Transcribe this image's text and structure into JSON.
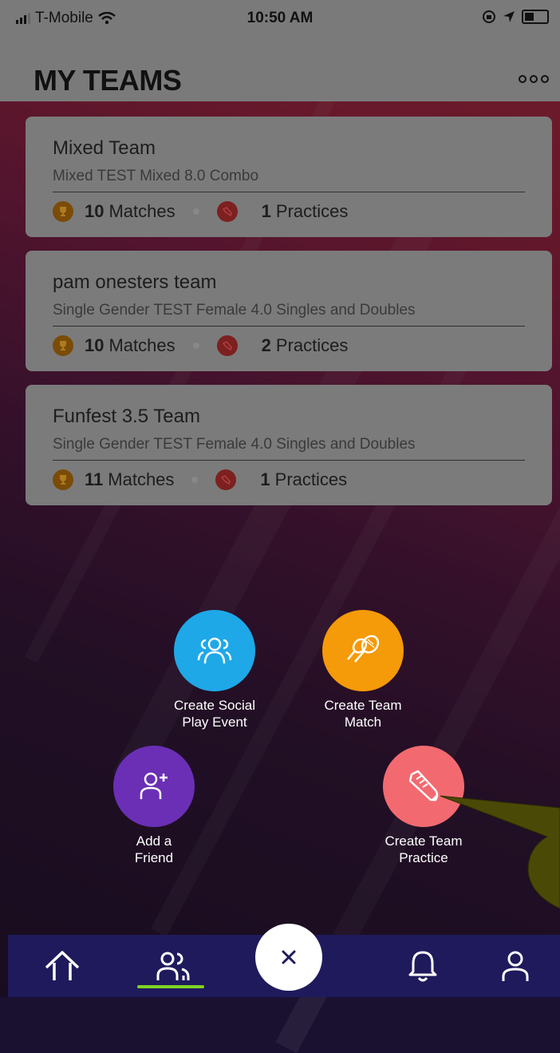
{
  "status_bar": {
    "carrier": "T-Mobile",
    "time": "10:50 AM"
  },
  "header": {
    "title": "MY TEAMS",
    "more_icon": "more-dots-icon"
  },
  "teams": [
    {
      "name": "Mixed Team",
      "subtitle": "Mixed TEST Mixed 8.0 Combo",
      "matches_count": "10",
      "matches_label": "Matches",
      "practices_count": "1",
      "practices_label": "Practices"
    },
    {
      "name": "pam onesters team",
      "subtitle": "Single Gender TEST Female 4.0 Singles and Doubles",
      "matches_count": "10",
      "matches_label": "Matches",
      "practices_count": "2",
      "practices_label": "Practices"
    },
    {
      "name": "Funfest 3.5 Team",
      "subtitle": "Single Gender TEST Female 4.0 Singles and Doubles",
      "matches_count": "11",
      "matches_label": "Matches",
      "practices_count": "1",
      "practices_label": "Practices"
    }
  ],
  "actions": {
    "social": {
      "label_line1": "Create Social",
      "label_line2": "Play Event",
      "color": "#1ea8e8",
      "icon": "group-icon"
    },
    "match": {
      "label_line1": "Create Team",
      "label_line2": "Match",
      "color": "#f59a08",
      "icon": "tennis-rackets-icon"
    },
    "friend": {
      "label_line1": "Add a",
      "label_line2": "Friend",
      "color": "#6a2fb5",
      "icon": "add-user-icon"
    },
    "practice": {
      "label_line1": "Create Team",
      "label_line2": "Practice",
      "color": "#f26a70",
      "icon": "sneaker-icon"
    }
  },
  "nav": {
    "items": [
      "home-icon",
      "teams-icon",
      "close-icon",
      "bell-icon",
      "profile-icon"
    ],
    "active_color": "#7ed321",
    "bar_color": "#1f1a5c"
  }
}
